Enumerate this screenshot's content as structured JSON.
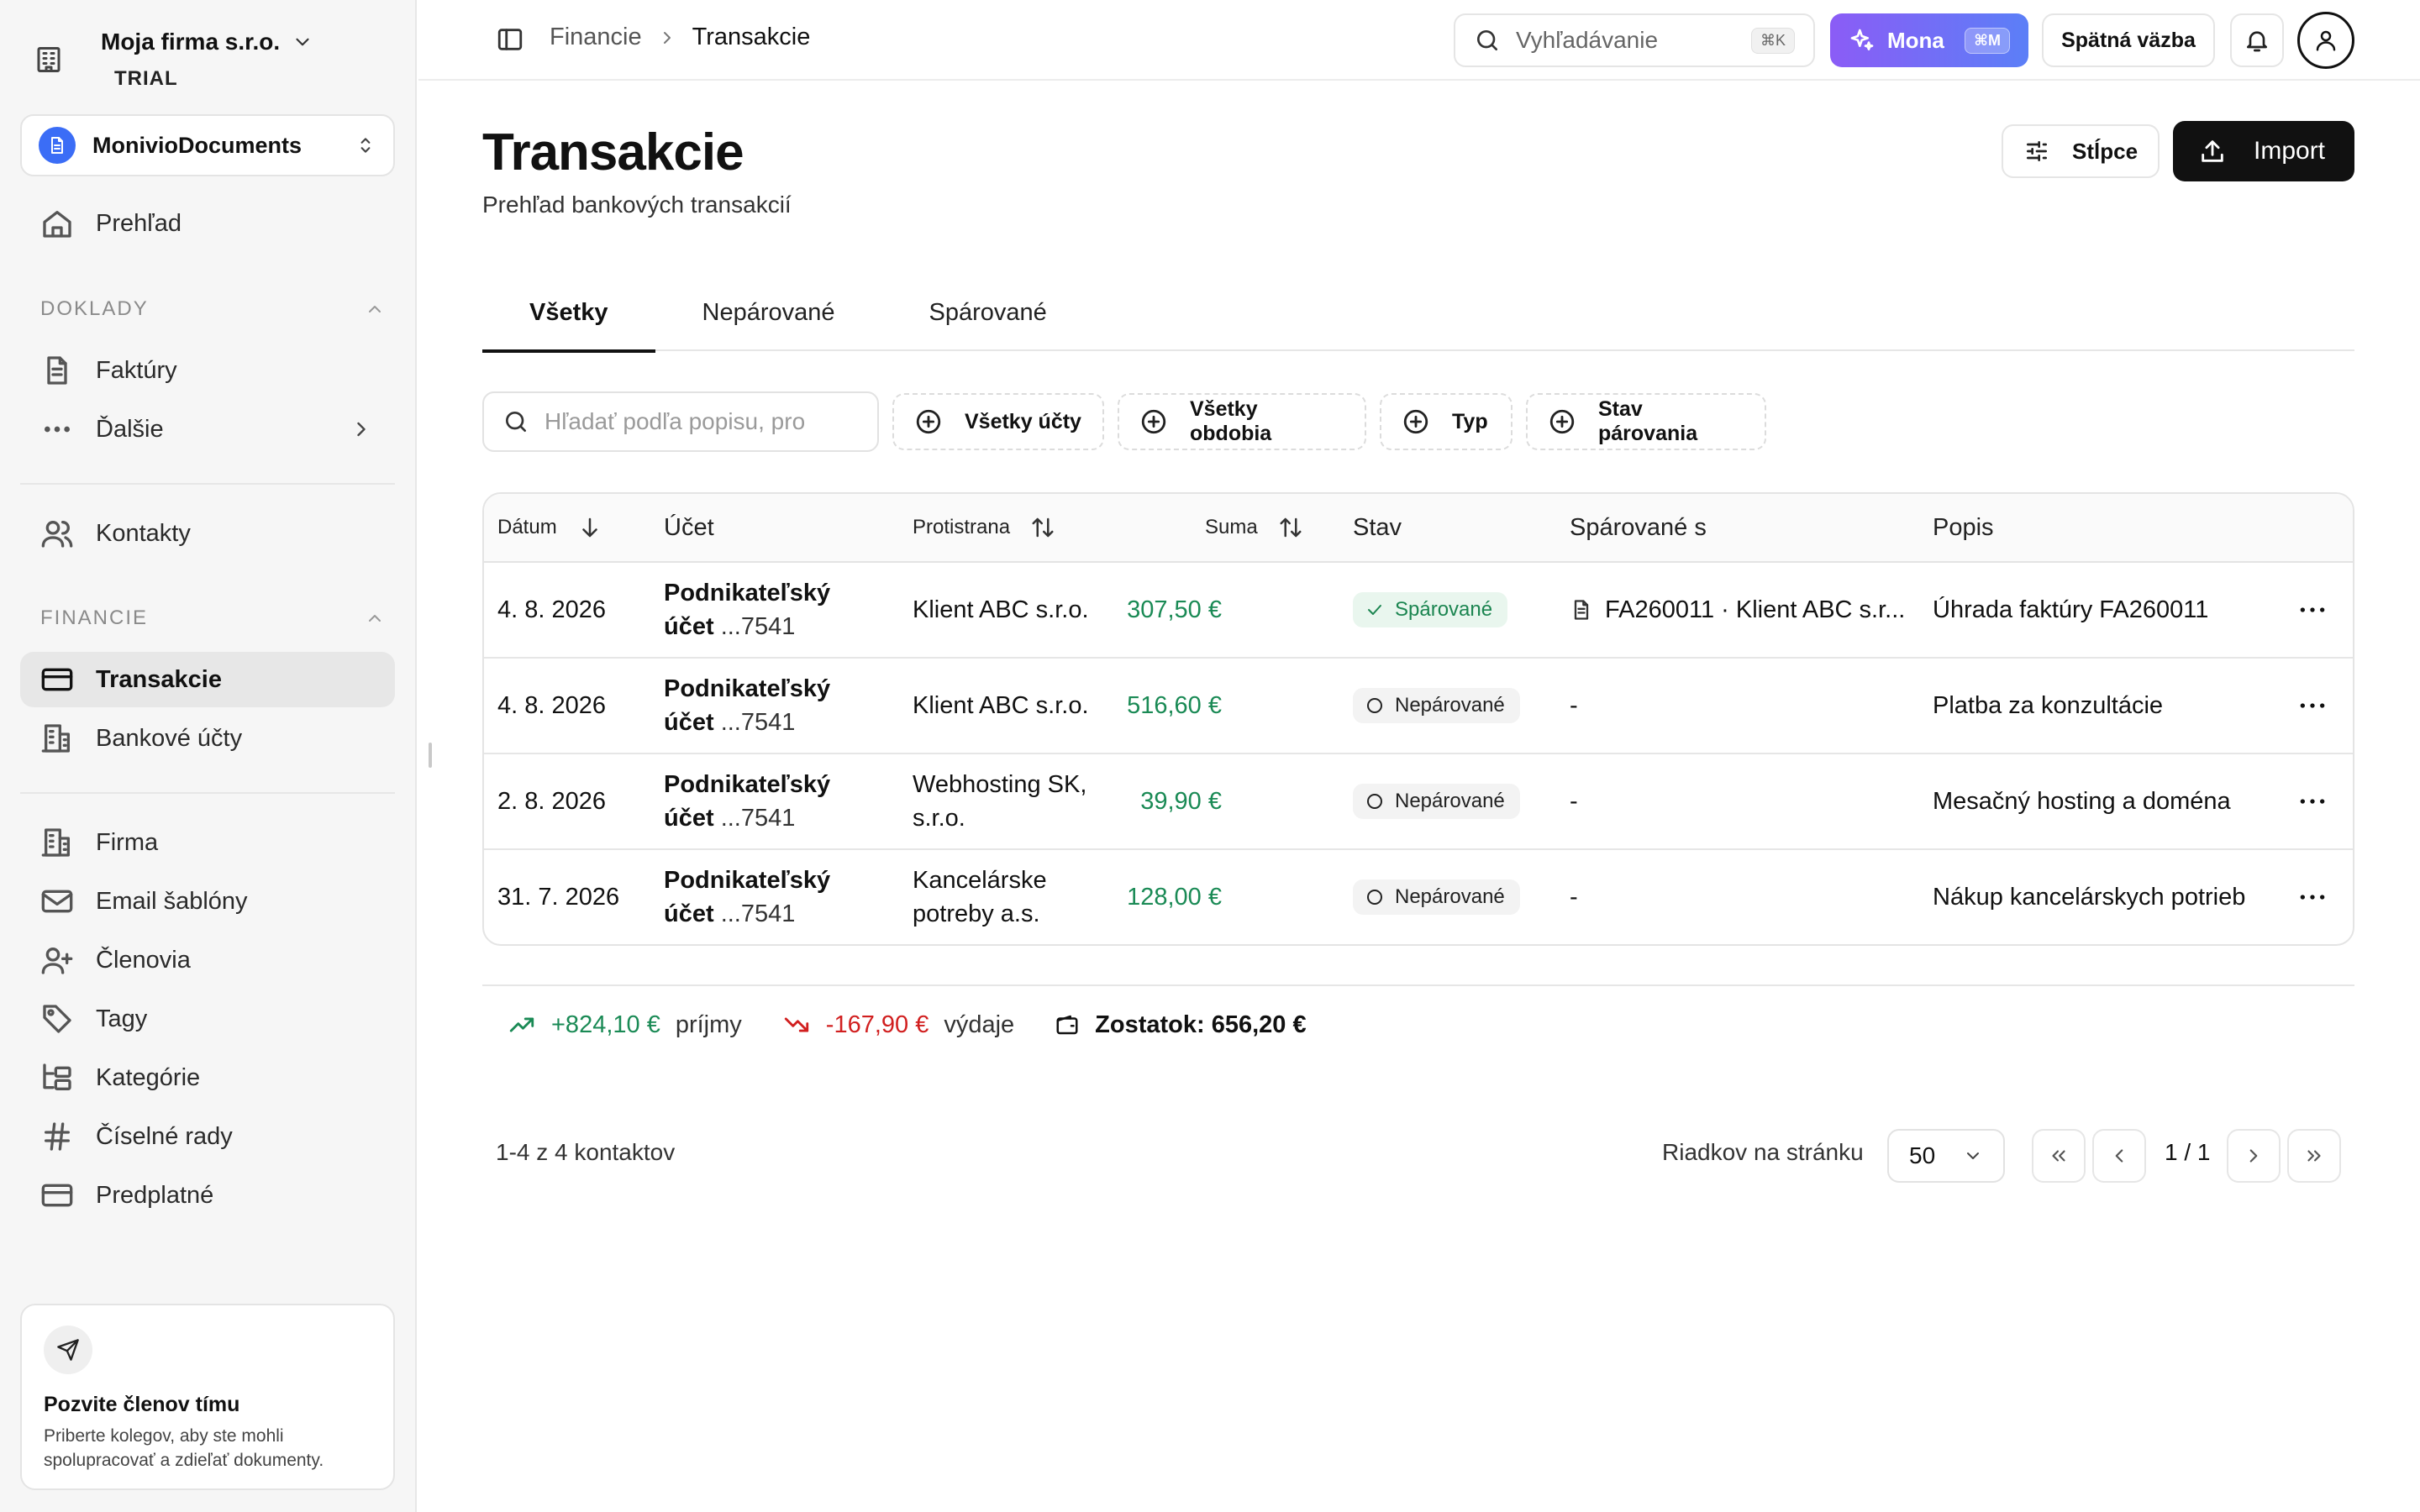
{
  "company": {
    "name": "Moja firma s.r.o.",
    "plan": "TRIAL"
  },
  "workspace": {
    "name": "MonivioDocuments"
  },
  "sidebar": {
    "overview": "Prehľad",
    "section_docs": "DOKLADY",
    "invoices": "Faktúry",
    "more": "Ďalšie",
    "contacts": "Kontakty",
    "section_finance": "FINANCIE",
    "transactions": "Transakcie",
    "bank_accounts": "Bankové účty",
    "company": "Firma",
    "email_templates": "Email šablóny",
    "members": "Členovia",
    "tags": "Tagy",
    "categories": "Kategórie",
    "number_series": "Číselné rady",
    "subscription": "Predplatné"
  },
  "invite": {
    "title": "Pozvite členov tímu",
    "text": "Priberte kolegov, aby ste mohli spolupracovať a zdieľať dokumenty."
  },
  "topbar": {
    "breadcrumb_parent": "Financie",
    "breadcrumb_current": "Transakcie",
    "search_placeholder": "Vyhľadávanie",
    "search_shortcut": "⌘K",
    "mona_label": "Mona",
    "mona_shortcut": "⌘M",
    "feedback_label": "Spätná väzba"
  },
  "page": {
    "title": "Transakcie",
    "subtitle": "Prehľad bankových transakcií",
    "columns_button": "Stĺpce",
    "import_button": "Import"
  },
  "tabs": [
    "Všetky",
    "Nepárované",
    "Spárované"
  ],
  "filters": {
    "search_placeholder": "Hľadať podľa popisu, pro",
    "accounts": "Všetky účty",
    "periods": "Všetky obdobia",
    "type": "Typ",
    "pairing_status": "Stav párovania"
  },
  "table": {
    "headers": {
      "date": "Dátum",
      "account": "Účet",
      "counterparty": "Protistrana",
      "amount": "Suma",
      "status": "Stav",
      "matched": "Spárované s",
      "description": "Popis"
    },
    "rows": [
      {
        "date": "4. 8. 2026",
        "account_name": "Podnikateľský",
        "account_word": "účet",
        "account_suffix": " ...7541",
        "counterparty": "Klient ABC s.r.o.",
        "amount": "307,50 €",
        "status": "Spárované",
        "matched": "FA260011 · Klient ABC s.r...",
        "description": "Úhrada faktúry FA260011"
      },
      {
        "date": "4. 8. 2026",
        "account_name": "Podnikateľský",
        "account_word": "účet",
        "account_suffix": " ...7541",
        "counterparty": "Klient ABC s.r.o.",
        "amount": "516,60 €",
        "status": "Nepárované",
        "matched": "-",
        "description": "Platba za konzultácie"
      },
      {
        "date": "2. 8. 2026",
        "account_name": "Podnikateľský",
        "account_word": "účet",
        "account_suffix": " ...7541",
        "counterparty": "Webhosting SK, s.r.o.",
        "amount": "39,90 €",
        "status": "Nepárované",
        "matched": "-",
        "description": "Mesačný hosting a doména"
      },
      {
        "date": "31. 7. 2026",
        "account_name": "Podnikateľský",
        "account_word": "účet",
        "account_suffix": " ...7541",
        "counterparty": "Kancelárske potreby a.s.",
        "amount": "128,00 €",
        "status": "Nepárované",
        "matched": "-",
        "description": "Nákup kancelárskych potrieb"
      }
    ]
  },
  "summary": {
    "income": "+824,10 €",
    "income_label": "príjmy",
    "expense": "-167,90 €",
    "expense_label": "výdaje",
    "balance": "Zostatok: 656,20 €"
  },
  "pagination": {
    "info": "1-4 z 4 kontaktov",
    "rows_label": "Riadkov na stránku",
    "rows_value": "50",
    "page": "1 / 1"
  },
  "colors": {
    "accent_gradient_start": "#8b5cf6",
    "accent_gradient_end": "#5b7ff7",
    "positive": "#1a8a55",
    "negative": "#d11f1f",
    "workspace_logo": "#3b6df6"
  }
}
